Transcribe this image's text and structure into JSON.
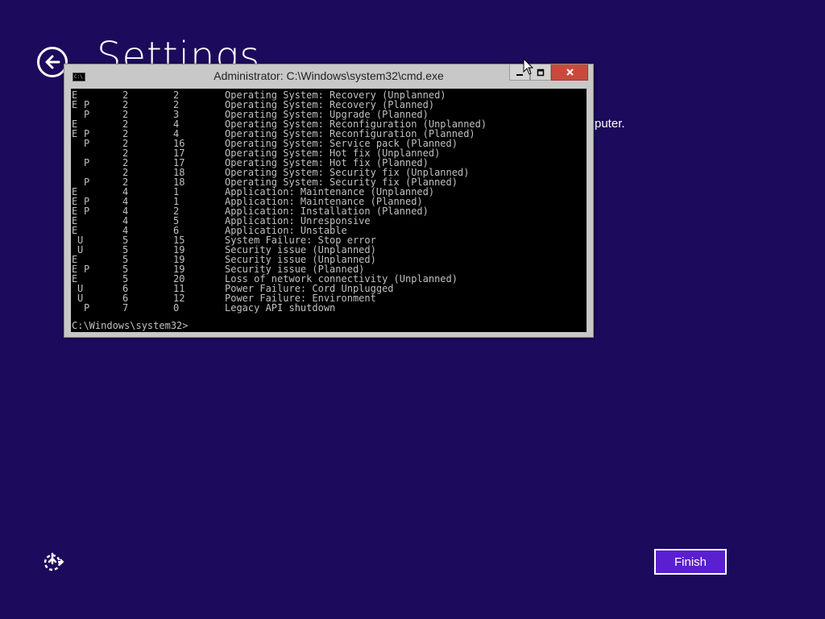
{
  "page": {
    "title": "Settings",
    "partial_text": "puter."
  },
  "window": {
    "title": "Administrator: C:\\Windows\\system32\\cmd.exe",
    "icon_text": "C:\\",
    "min_icon": "minimize-icon",
    "max_icon": "maximize-icon",
    "close_icon": "close-icon"
  },
  "console": {
    "rows": [
      {
        "e": "E",
        "u": "",
        "p": "",
        "major": "2",
        "minor": "2",
        "desc": "Operating System: Recovery (Unplanned)"
      },
      {
        "e": "E",
        "u": "",
        "p": "P",
        "major": "2",
        "minor": "2",
        "desc": "Operating System: Recovery (Planned)"
      },
      {
        "e": "",
        "u": "",
        "p": "P",
        "major": "2",
        "minor": "3",
        "desc": "Operating System: Upgrade (Planned)"
      },
      {
        "e": "E",
        "u": "",
        "p": "",
        "major": "2",
        "minor": "4",
        "desc": "Operating System: Reconfiguration (Unplanned)"
      },
      {
        "e": "E",
        "u": "",
        "p": "P",
        "major": "2",
        "minor": "4",
        "desc": "Operating System: Reconfiguration (Planned)"
      },
      {
        "e": "",
        "u": "",
        "p": "P",
        "major": "2",
        "minor": "16",
        "desc": "Operating System: Service pack (Planned)"
      },
      {
        "e": "",
        "u": "",
        "p": "",
        "major": "2",
        "minor": "17",
        "desc": "Operating System: Hot fix (Unplanned)"
      },
      {
        "e": "",
        "u": "",
        "p": "P",
        "major": "2",
        "minor": "17",
        "desc": "Operating System: Hot fix (Planned)"
      },
      {
        "e": "",
        "u": "",
        "p": "",
        "major": "2",
        "minor": "18",
        "desc": "Operating System: Security fix (Unplanned)"
      },
      {
        "e": "",
        "u": "",
        "p": "P",
        "major": "2",
        "minor": "18",
        "desc": "Operating System: Security fix (Planned)"
      },
      {
        "e": "E",
        "u": "",
        "p": "",
        "major": "4",
        "minor": "1",
        "desc": "Application: Maintenance (Unplanned)"
      },
      {
        "e": "E",
        "u": "",
        "p": "P",
        "major": "4",
        "minor": "1",
        "desc": "Application: Maintenance (Planned)"
      },
      {
        "e": "E",
        "u": "",
        "p": "P",
        "major": "4",
        "minor": "2",
        "desc": "Application: Installation (Planned)"
      },
      {
        "e": "E",
        "u": "",
        "p": "",
        "major": "4",
        "minor": "5",
        "desc": "Application: Unresponsive"
      },
      {
        "e": "E",
        "u": "",
        "p": "",
        "major": "4",
        "minor": "6",
        "desc": "Application: Unstable"
      },
      {
        "e": "",
        "u": "U",
        "p": "",
        "major": "5",
        "minor": "15",
        "desc": "System Failure: Stop error"
      },
      {
        "e": "",
        "u": "U",
        "p": "",
        "major": "5",
        "minor": "19",
        "desc": "Security issue (Unplanned)"
      },
      {
        "e": "E",
        "u": "",
        "p": "",
        "major": "5",
        "minor": "19",
        "desc": "Security issue (Unplanned)"
      },
      {
        "e": "E",
        "u": "",
        "p": "P",
        "major": "5",
        "minor": "19",
        "desc": "Security issue (Planned)"
      },
      {
        "e": "E",
        "u": "",
        "p": "",
        "major": "5",
        "minor": "20",
        "desc": "Loss of network connectivity (Unplanned)"
      },
      {
        "e": "",
        "u": "U",
        "p": "",
        "major": "6",
        "minor": "11",
        "desc": "Power Failure: Cord Unplugged"
      },
      {
        "e": "",
        "u": "U",
        "p": "",
        "major": "6",
        "minor": "12",
        "desc": "Power Failure: Environment"
      },
      {
        "e": "",
        "u": "",
        "p": "P",
        "major": "7",
        "minor": "0",
        "desc": "Legacy API shutdown"
      }
    ],
    "prompt": "C:\\Windows\\system32>"
  },
  "footer": {
    "finish_label": "Finish",
    "left_icon": "ease-of-access-icon"
  },
  "colors": {
    "background": "#1c0a5c",
    "accent_button": "#5a1fd0",
    "close_button": "#c94a3c",
    "console_text": "#c0c0c0"
  }
}
